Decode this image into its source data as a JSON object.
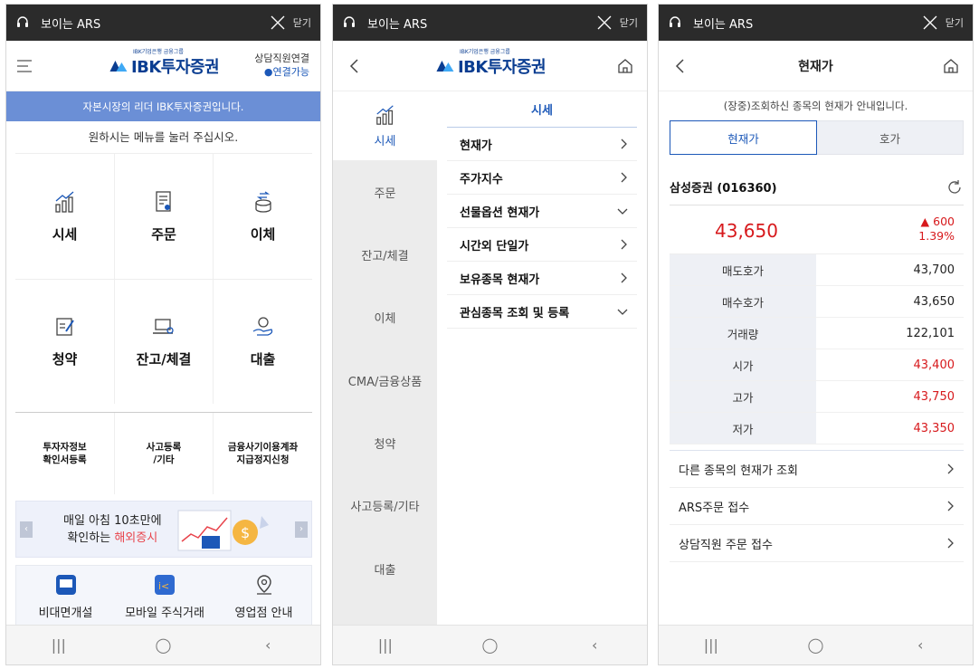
{
  "ars": {
    "title": "보이는 ARS",
    "close_label": "닫기"
  },
  "phone1": {
    "logo_sub": "IBK기업은행 금융그룹",
    "logo_name": "IBK투자증권",
    "consult_title": "상담직원연결",
    "consult_status": "연결가능",
    "banner": "자본시장의 리더 IBK투자증권입니다.",
    "guide": "원하시는 메뉴를 눌러 주십시오.",
    "main_menu": [
      "시세",
      "주문",
      "이체",
      "청약",
      "잔고/체결",
      "대출"
    ],
    "sub_menu": [
      "투자자정보\n확인서등록",
      "사고등록\n/기타",
      "금융사기이용계좌\n지급정지신청"
    ],
    "promo_line1": "매일 아침 10초만에",
    "promo_line2_prefix": "확인하는",
    "promo_line2_highlight": "해외증시",
    "bottom": [
      "비대면개설",
      "모바일 주식거래",
      "영업점 안내"
    ]
  },
  "phone2": {
    "logo_sub": "IBK기업은행 금융그룹",
    "logo_name": "IBK투자증권",
    "sidebar": [
      "시세",
      "주문",
      "잔고/체결",
      "이체",
      "CMA/금융상품",
      "청약",
      "사고등록/기타",
      "대출"
    ],
    "section_title": "시세",
    "items": [
      "현재가",
      "주가지수",
      "선물옵션 현재가",
      "시간외 단일가",
      "보유종목 현재가",
      "관심종목 조회 및 등록"
    ],
    "item_chevrons": [
      "right",
      "right",
      "down",
      "right",
      "right",
      "down"
    ]
  },
  "phone3": {
    "title": "현재가",
    "notice": "(장중)조회하신 종목의 현재가 안내입니다.",
    "tabs": [
      "현재가",
      "호가"
    ],
    "stock_name": "삼성증권 (016360)",
    "price": "43,650",
    "change": "▲ 600",
    "change_pct": "1.39%",
    "quotes": [
      {
        "k": "매도호가",
        "v": "43,700",
        "red": false
      },
      {
        "k": "매수호가",
        "v": "43,650",
        "red": false
      },
      {
        "k": "거래량",
        "v": "122,101",
        "red": false
      },
      {
        "k": "시가",
        "v": "43,400",
        "red": true
      },
      {
        "k": "고가",
        "v": "43,750",
        "red": true
      },
      {
        "k": "저가",
        "v": "43,350",
        "red": true
      }
    ],
    "links": [
      "다른 종목의 현재가 조회",
      "ARS주문 접수",
      "상담직원 주문 접수"
    ]
  },
  "colors": {
    "brand": "#0a3d91",
    "accent": "#1c58b8",
    "banner": "#6b8fd6",
    "up_red": "#d7191c"
  }
}
